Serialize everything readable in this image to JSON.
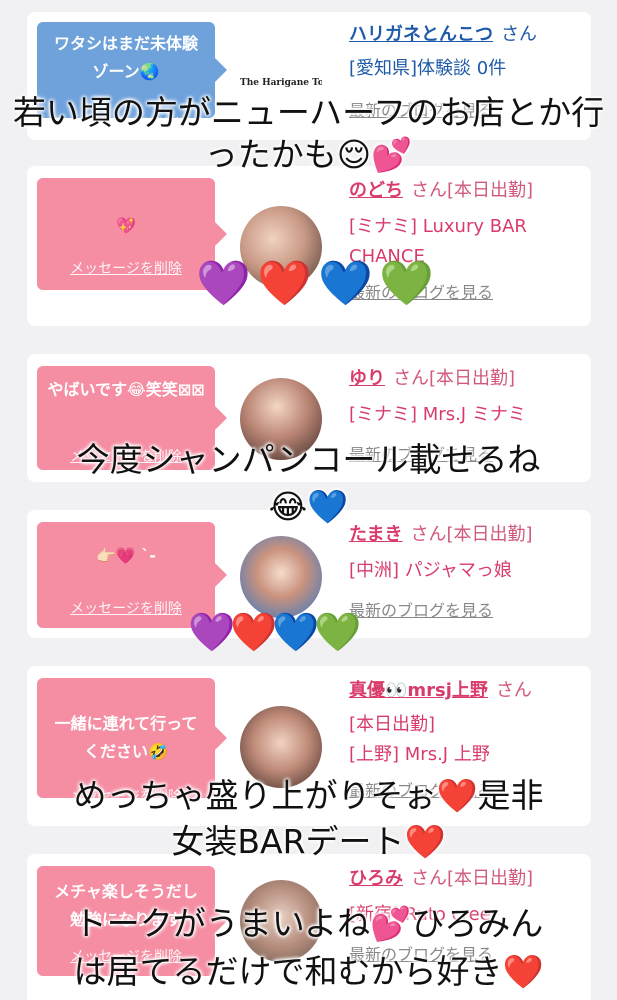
{
  "cards": [
    {
      "bubble_text": "ワタシはまだ未体験ゾーン🌏",
      "delete_label": "メッセージを削除",
      "avatar_text": "The Harigane Tonkotsu",
      "name": "ハリガネとんこつ",
      "honorific": "さん",
      "line2": "[愛知県]体験談 0件",
      "line3": "",
      "blog_label": "最新のブログを見る",
      "color": "#6fa2db"
    },
    {
      "bubble_text": "💖",
      "delete_label": "メッセージを削除",
      "name": "のどち",
      "honorific": "さん[本日出勤]",
      "line2": "[ミナミ] Luxury BAR",
      "line3": "CHANCE",
      "blog_label": "最新のブログを見る",
      "color": "#f58ea3"
    },
    {
      "bubble_text": "やばいです😂笑笑⊠⊠",
      "delete_label": "メッセージを削除",
      "name": "ゆり",
      "honorific": "さん[本日出勤]",
      "line2": "[ミナミ] Mrs.J ミナミ",
      "line3": "",
      "blog_label": "最新のブログを見る",
      "color": "#f58ea3"
    },
    {
      "bubble_text": "👉🏻💗 ˋ-",
      "delete_label": "メッセージを削除",
      "name": "たまき",
      "honorific": "さん[本日出勤]",
      "line2": "[中洲] パジャマっ娘",
      "line3": "",
      "blog_label": "最新のブログを見る",
      "color": "#f58ea3"
    },
    {
      "bubble_text": "一緒に連れて行ってください🤣",
      "delete_label": "メッセージを削除",
      "name": "真優👀mrsj上野",
      "honorific": "さん",
      "line2": "[本日出勤]",
      "line3": "[上野] Mrs.J 上野",
      "blog_label": "最新のブログを見る",
      "color": "#f58ea3"
    },
    {
      "bubble_text": "メチャ楽しそうだし勉強になります",
      "delete_label": "メッセージを削除",
      "name": "ひろみ",
      "honorific": "さん[本日出勤]",
      "line2": "[新宿] Ruto creer",
      "line3": "",
      "blog_label": "最新のブログを見る",
      "color": "#f58ea3"
    }
  ],
  "overlays": {
    "top_line1": "若い頃の方がニューハーフのお店とか行",
    "top_line2": "ったかも😌💕",
    "mid": "今度シャンパンコール載せるね",
    "mid_emoji": "😂💙",
    "lower_line1": "めっちゃ盛り上がりそぉ❤️是非",
    "lower_line2": "女装BARデート❤️",
    "bottom_line1": "トークがうまいよね💕ひろみん",
    "bottom_line2": "は居てるだけで和むから好き❤️"
  },
  "hearts": {
    "row1": [
      "💜",
      "❤️",
      "💙",
      "💚"
    ],
    "row2": [
      "💜",
      "❤️",
      "💙",
      "💚"
    ]
  },
  "colors": {
    "name_blue": "#1e5aa8",
    "name_pink": "#d93c6b",
    "bubble_blue": "#6fa2db",
    "bubble_pink": "#f58ea3"
  }
}
